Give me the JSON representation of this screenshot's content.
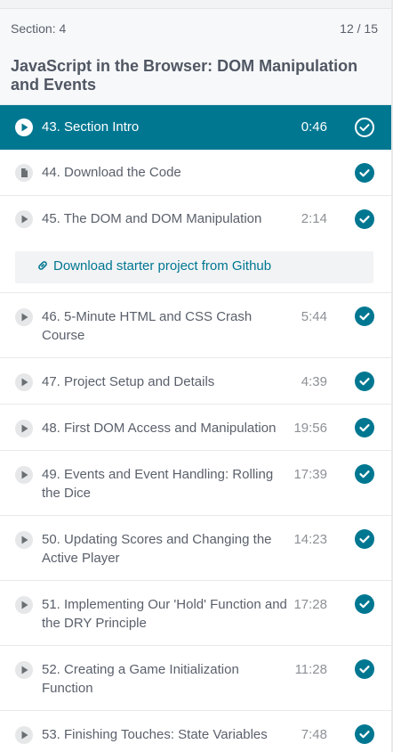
{
  "section": {
    "label": "Section: 4",
    "count": "12 / 15",
    "title": "JavaScript in the Browser: DOM Manipulation and Events"
  },
  "lectures": [
    {
      "title": "43. Section Intro",
      "duration": "0:46",
      "type": "video",
      "completed": true,
      "active": true
    },
    {
      "title": "44. Download the Code",
      "duration": "",
      "type": "file",
      "completed": true,
      "active": false
    },
    {
      "title": "45. The DOM and DOM Manipulation",
      "duration": "2:14",
      "type": "video",
      "completed": true,
      "active": false
    },
    {
      "title": "46. 5-Minute HTML and CSS Crash Course",
      "duration": "5:44",
      "type": "video",
      "completed": true,
      "active": false
    },
    {
      "title": "47. Project Setup and Details",
      "duration": "4:39",
      "type": "video",
      "completed": true,
      "active": false
    },
    {
      "title": "48. First DOM Access and Manipulation",
      "duration": "19:56",
      "type": "video",
      "completed": true,
      "active": false
    },
    {
      "title": "49. Events and Event Handling: Rolling the Dice",
      "duration": "17:39",
      "type": "video",
      "completed": true,
      "active": false
    },
    {
      "title": "50. Updating Scores and Changing the Active Player",
      "duration": "14:23",
      "type": "video",
      "completed": true,
      "active": false
    },
    {
      "title": "51. Implementing Our 'Hold' Function and the DRY Principle",
      "duration": "17:28",
      "type": "video",
      "completed": true,
      "active": false
    },
    {
      "title": "52. Creating a Game Initialization Function",
      "duration": "11:28",
      "type": "video",
      "completed": true,
      "active": false
    },
    {
      "title": "53. Finishing Touches: State Variables",
      "duration": "7:48",
      "type": "video",
      "completed": true,
      "active": false
    }
  ],
  "resource": {
    "label": "Download starter project from Github",
    "icon": "link-icon"
  },
  "colors": {
    "accent": "#007791",
    "active_row": "#007791",
    "text": "#505763",
    "muted": "#8d9096"
  }
}
